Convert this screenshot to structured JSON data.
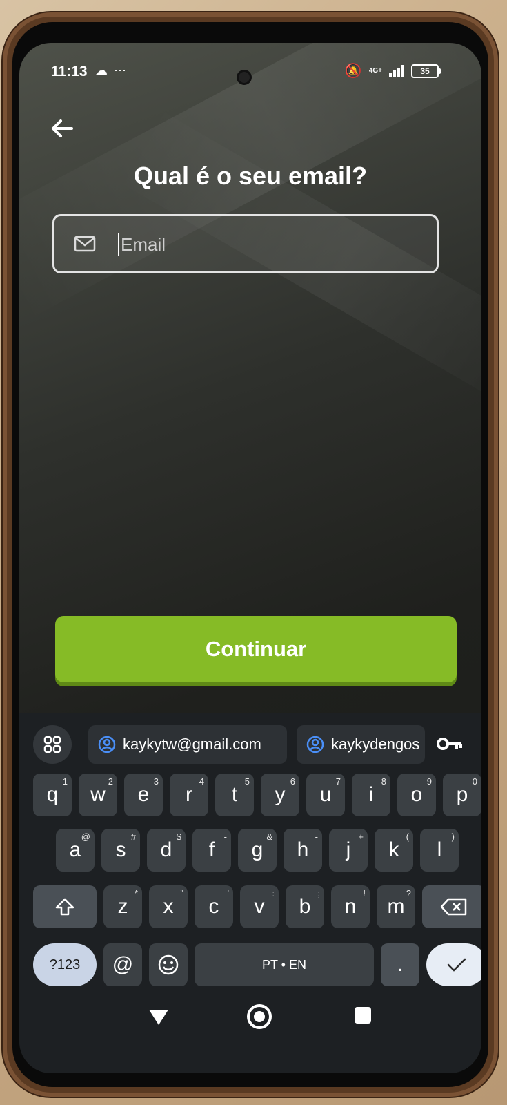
{
  "status_bar": {
    "time": "11:13",
    "network": "4G+",
    "battery": "35"
  },
  "page": {
    "title": "Qual é o seu email?",
    "email_placeholder": "Email",
    "continue_label": "Continuar"
  },
  "keyboard": {
    "suggestions": [
      "kaykytw@gmail.com",
      "kaykydengos"
    ],
    "row1": [
      {
        "key": "q",
        "alt": "1"
      },
      {
        "key": "w",
        "alt": "2"
      },
      {
        "key": "e",
        "alt": "3"
      },
      {
        "key": "r",
        "alt": "4"
      },
      {
        "key": "t",
        "alt": "5"
      },
      {
        "key": "y",
        "alt": "6"
      },
      {
        "key": "u",
        "alt": "7"
      },
      {
        "key": "i",
        "alt": "8"
      },
      {
        "key": "o",
        "alt": "9"
      },
      {
        "key": "p",
        "alt": "0"
      }
    ],
    "row2": [
      {
        "key": "a",
        "alt": "@"
      },
      {
        "key": "s",
        "alt": "#"
      },
      {
        "key": "d",
        "alt": "$"
      },
      {
        "key": "f",
        "alt": "-"
      },
      {
        "key": "g",
        "alt": "&"
      },
      {
        "key": "h",
        "alt": "-"
      },
      {
        "key": "j",
        "alt": "+"
      },
      {
        "key": "k",
        "alt": "("
      },
      {
        "key": "l",
        "alt": ")"
      }
    ],
    "row3": [
      {
        "key": "z",
        "alt": "*"
      },
      {
        "key": "x",
        "alt": "\""
      },
      {
        "key": "c",
        "alt": "'"
      },
      {
        "key": "v",
        "alt": ":"
      },
      {
        "key": "b",
        "alt": ";"
      },
      {
        "key": "n",
        "alt": "!"
      },
      {
        "key": "m",
        "alt": "?"
      }
    ],
    "symbols_label": "?123",
    "at_label": "@",
    "space_label": "PT • EN",
    "period_label": "."
  },
  "colors": {
    "accent_green": "#86bb26",
    "keyboard_bg": "#1d2023",
    "key_bg": "#3b4044"
  }
}
